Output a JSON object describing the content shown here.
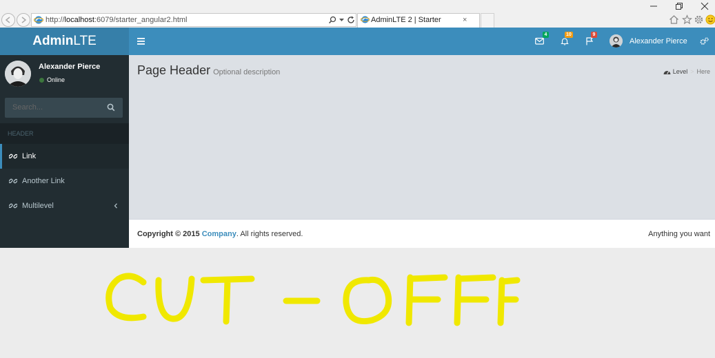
{
  "browser": {
    "url_prefix": "http://",
    "url_host": "localhost",
    "url_rest": ":6079/starter_angular2.html",
    "tab_title": "AdminLTE 2 | Starter",
    "tab_close": "×"
  },
  "header": {
    "logo_bold": "Admin",
    "logo_light": "LTE",
    "mail_count": "4",
    "notification_count": "10",
    "task_count": "9",
    "user_name": "Alexander Pierce"
  },
  "sidebar": {
    "user_name": "Alexander Pierce",
    "status": "Online",
    "search_placeholder": "Search...",
    "header_label": "HEADER",
    "items": [
      {
        "label": "Link",
        "active": true
      },
      {
        "label": "Another Link",
        "active": false
      },
      {
        "label": "Multilevel",
        "active": false
      }
    ]
  },
  "content": {
    "title": "Page Header",
    "description": "Optional description",
    "breadcrumb_level": "Level",
    "breadcrumb_sep": ">",
    "breadcrumb_here": "Here"
  },
  "footer": {
    "copyright_prefix": "Copyright © 2015 ",
    "company": "Company",
    "copyright_suffix": ". All rights reserved.",
    "right_text": "Anything you want"
  },
  "annotation": {
    "text": "CUT - OFF",
    "color": "#f0e800"
  },
  "colors": {
    "logo_bg": "#367fa9",
    "navbar_bg": "#3c8dbc",
    "sidebar_bg": "#222d32",
    "content_bg": "#dce0e5"
  }
}
